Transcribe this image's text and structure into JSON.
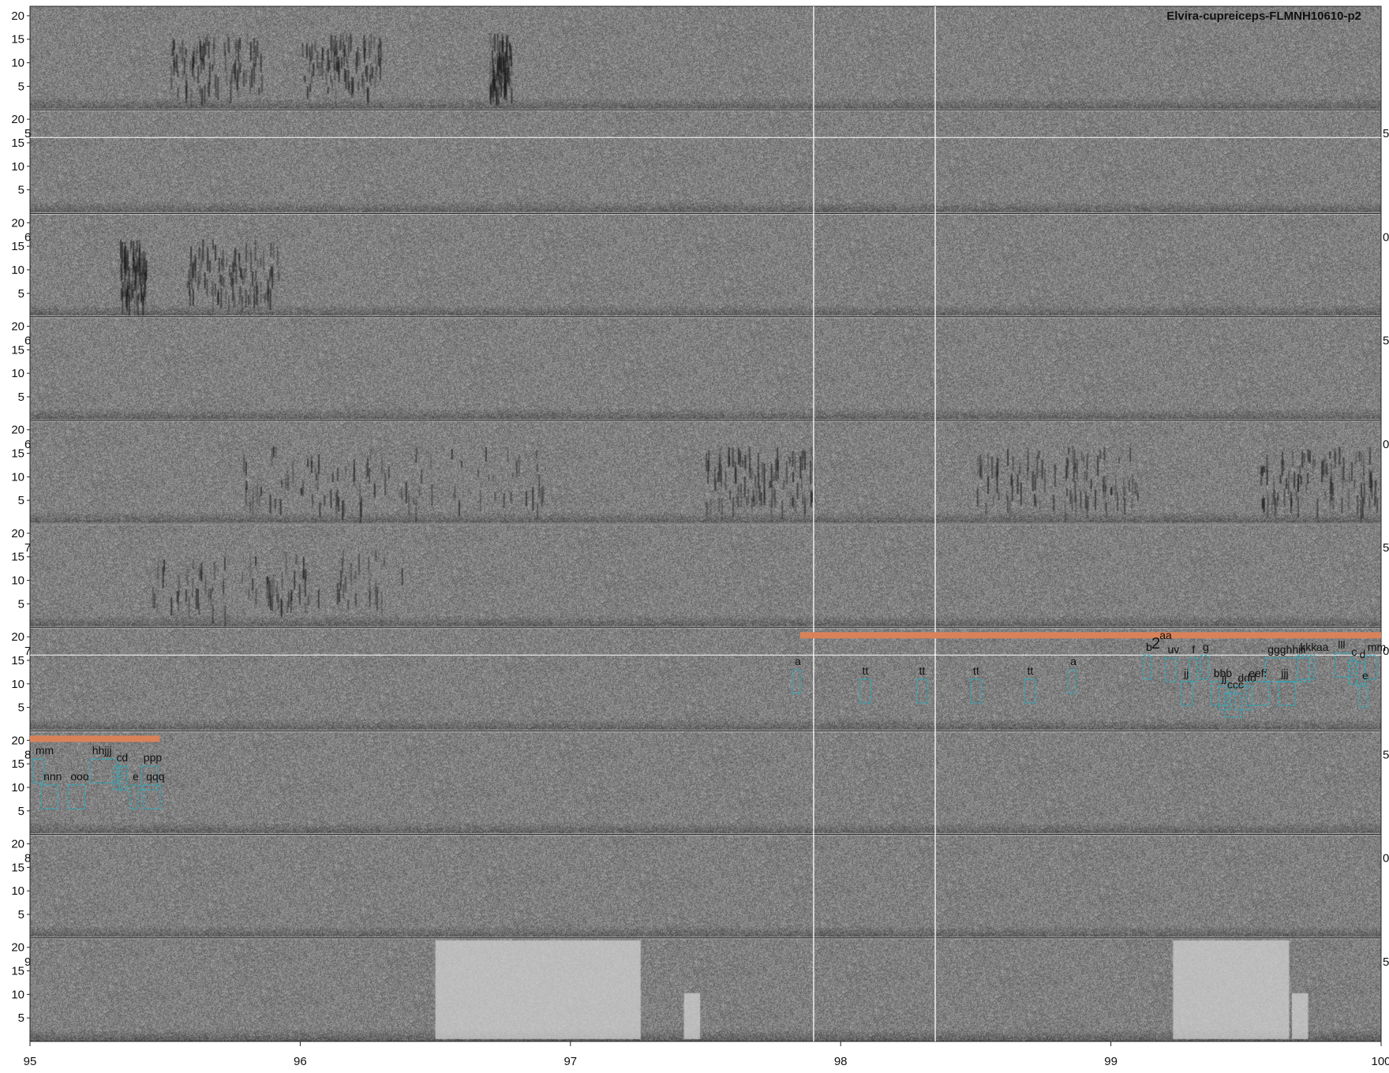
{
  "figure": {
    "title": "Elvira-cupreiceps-FLMNH10610-p2"
  },
  "chart_data": {
    "type": "heatmap",
    "description_kind": "stacked spectrogram rows",
    "title": "Elvira-cupreiceps-FLMNH10610-p2",
    "xlabel": "",
    "ylabel": "",
    "xlim": [
      95,
      100
    ],
    "x_ticks": [
      "95",
      "96",
      "97",
      "98",
      "99",
      "100"
    ],
    "y_ticks": [
      "5",
      "10",
      "15",
      "20"
    ],
    "ylim_khz": [
      0,
      22
    ],
    "rows": 10,
    "left_edge_labels": [
      "",
      "5",
      "6",
      "6",
      "6",
      "7",
      "7",
      "8",
      "8",
      "9"
    ],
    "right_edge_labels": [
      "",
      "5",
      "0",
      "5",
      "0",
      "5",
      "0",
      "5",
      "0",
      "5"
    ],
    "cursor_lines_x": [
      97.9,
      98.35
    ],
    "orange_bars": [
      {
        "row": 6,
        "x0": 97.85,
        "x1": 100.0
      },
      {
        "row": 7,
        "x0": 95.0,
        "x1": 95.48
      }
    ],
    "box_labels": [
      {
        "row": 6,
        "t": 97.83,
        "y": 14.0,
        "text": "a"
      },
      {
        "row": 6,
        "t": 98.08,
        "y": 12.0,
        "text": "tt"
      },
      {
        "row": 6,
        "t": 98.29,
        "y": 12.0,
        "text": "tt"
      },
      {
        "row": 6,
        "t": 98.49,
        "y": 12.0,
        "text": "tt"
      },
      {
        "row": 6,
        "t": 98.69,
        "y": 12.0,
        "text": "tt"
      },
      {
        "row": 6,
        "t": 98.85,
        "y": 14.0,
        "text": "a"
      },
      {
        "row": 6,
        "t": 99.15,
        "y": 17.5,
        "text": "2",
        "size": "large"
      },
      {
        "row": 6,
        "t": 99.18,
        "y": 19.5,
        "text": "aa"
      },
      {
        "row": 6,
        "t": 99.13,
        "y": 17.0,
        "text": "b"
      },
      {
        "row": 6,
        "t": 99.21,
        "y": 16.5,
        "text": "uv"
      },
      {
        "row": 6,
        "t": 99.3,
        "y": 16.5,
        "text": "f"
      },
      {
        "row": 6,
        "t": 99.34,
        "y": 17.0,
        "text": "g"
      },
      {
        "row": 6,
        "t": 99.27,
        "y": 11.5,
        "text": "jj"
      },
      {
        "row": 6,
        "t": 99.38,
        "y": 11.5,
        "text": "bbb"
      },
      {
        "row": 6,
        "t": 99.41,
        "y": 10.5,
        "text": "jj"
      },
      {
        "row": 6,
        "t": 99.43,
        "y": 9.0,
        "text": "ccc"
      },
      {
        "row": 6,
        "t": 99.47,
        "y": 10.5,
        "text": "ddd"
      },
      {
        "row": 6,
        "t": 99.51,
        "y": 11.5,
        "text": "eeff"
      },
      {
        "row": 6,
        "t": 99.58,
        "y": 16.5,
        "text": "ggghhiii"
      },
      {
        "row": 6,
        "t": 99.7,
        "y": 17.0,
        "text": "kkk"
      },
      {
        "row": 6,
        "t": 99.76,
        "y": 17.0,
        "text": "aa"
      },
      {
        "row": 6,
        "t": 99.84,
        "y": 17.5,
        "text": "lll"
      },
      {
        "row": 6,
        "t": 99.63,
        "y": 11.5,
        "text": "jjj"
      },
      {
        "row": 6,
        "t": 99.89,
        "y": 16.0,
        "text": "c"
      },
      {
        "row": 6,
        "t": 99.92,
        "y": 15.5,
        "text": "d"
      },
      {
        "row": 6,
        "t": 99.95,
        "y": 17.0,
        "text": "mm"
      },
      {
        "row": 6,
        "t": 99.93,
        "y": 11.0,
        "text": "e"
      },
      {
        "row": 7,
        "t": 95.02,
        "y": 17.0,
        "text": "mm"
      },
      {
        "row": 7,
        "t": 95.05,
        "y": 11.5,
        "text": "nnn"
      },
      {
        "row": 7,
        "t": 95.15,
        "y": 11.5,
        "text": "ooo"
      },
      {
        "row": 7,
        "t": 95.23,
        "y": 17.0,
        "text": "hhjjj"
      },
      {
        "row": 7,
        "t": 95.32,
        "y": 15.5,
        "text": "c"
      },
      {
        "row": 7,
        "t": 95.34,
        "y": 15.5,
        "text": "d"
      },
      {
        "row": 7,
        "t": 95.38,
        "y": 11.5,
        "text": "e"
      },
      {
        "row": 7,
        "t": 95.42,
        "y": 15.5,
        "text": "ppp"
      },
      {
        "row": 7,
        "t": 95.43,
        "y": 11.5,
        "text": "qqq"
      }
    ]
  }
}
